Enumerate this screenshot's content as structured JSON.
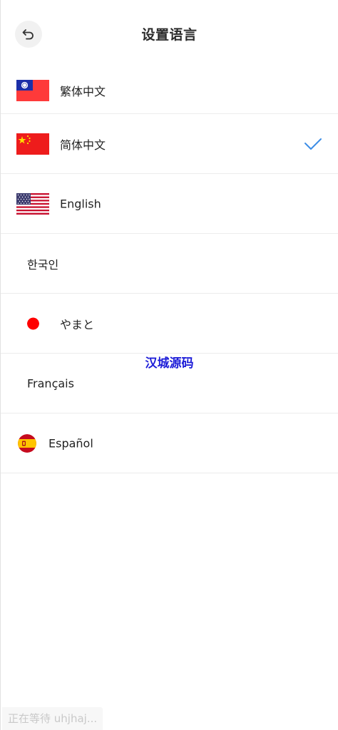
{
  "header": {
    "title": "设置语言",
    "back_icon": "undo-arrow-icon"
  },
  "languages": [
    {
      "label": "繁体中文",
      "flag": "taiwan-flag-icon",
      "selected": false
    },
    {
      "label": "简体中文",
      "flag": "china-flag-icon",
      "selected": true
    },
    {
      "label": "English",
      "flag": "us-flag-icon",
      "selected": false
    },
    {
      "label": "한국인",
      "flag": null,
      "selected": false
    },
    {
      "label": "やまと",
      "flag": "red-dot-icon",
      "selected": false
    },
    {
      "label": "Français",
      "flag": null,
      "selected": false
    },
    {
      "label": "Español",
      "flag": "spain-flag-icon",
      "selected": false
    }
  ],
  "selected_icon": "checkmark-icon",
  "watermark": "汉城源码",
  "status_bar": {
    "text": "正在等待 uhjhaj..."
  },
  "colors": {
    "accent": "#3d8ee6",
    "watermark": "#1d1dd8",
    "divider": "#ececec"
  }
}
